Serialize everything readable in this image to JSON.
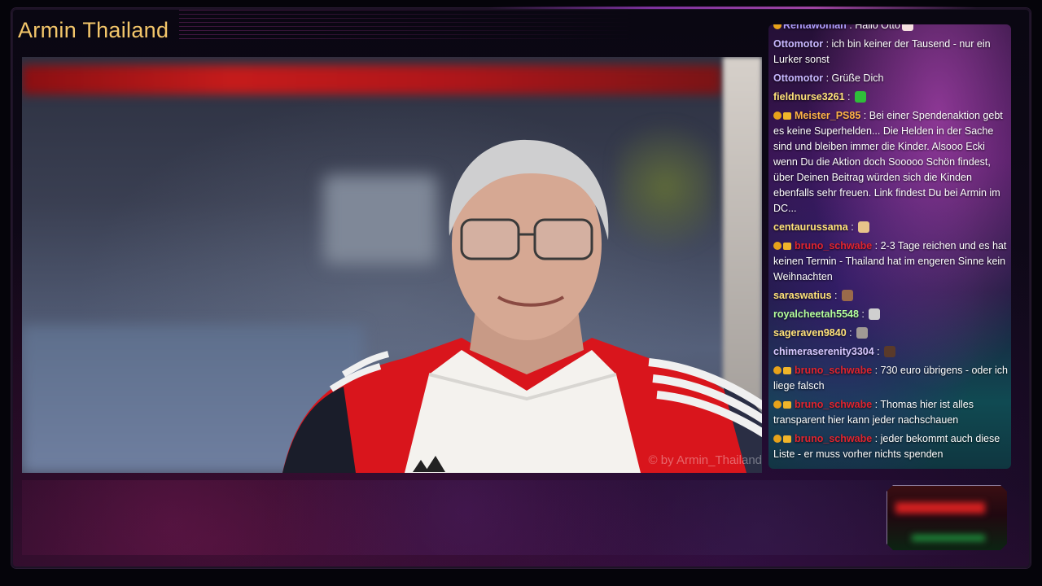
{
  "channel": {
    "title": "Armin Thailand"
  },
  "video": {
    "watermark": "© by Armin_Thailand"
  },
  "chat": {
    "messages": [
      {
        "user": "Rentawoman",
        "sep": " : ",
        "text": "Hallo Otto",
        "user_color": "#b0a0ff",
        "badges": 1,
        "emoji": "#f5e0e0"
      },
      {
        "user": "Ottomotor",
        "sep": " : ",
        "text": "ich bin keiner der Tausend - nur ein Lurker sonst",
        "user_color": "#c8b8ff",
        "badges": 0
      },
      {
        "user": "Ottomotor",
        "sep": " : ",
        "text": "Grüße Dich",
        "user_color": "#c8b8ff",
        "badges": 0
      },
      {
        "user": "fieldnurse3261",
        "sep": " : ",
        "text": "",
        "user_color": "#ffe27a",
        "badges": 0,
        "emoji": "#2fbd3a"
      },
      {
        "user": "Meister_PS85",
        "sep": " : ",
        "text": "Bei einer Spendenaktion gebt es keine Superhelden... Die Helden in der Sache sind und bleiben immer die Kinder. Alsooo Ecki wenn Du die Aktion doch Sooooo Schön findest, über Deinen Beitrag würden sich die Kinden ebenfalls sehr freuen. Link findest Du bei Armin im DC...",
        "user_color": "#ffb347",
        "badges": 2
      },
      {
        "user": "centaurussama",
        "sep": " : ",
        "text": "",
        "user_color": "#ffe27a",
        "badges": 0,
        "emoji": "#e8c38a"
      },
      {
        "user": "bruno_schwabe",
        "sep": " : ",
        "text": "2-3 Tage reichen und es hat keinen Termin - Thailand hat im engeren Sinne kein Weihnachten",
        "user_color": "#e0242f",
        "badges": 2
      },
      {
        "user": "saraswatius",
        "sep": " : ",
        "text": "",
        "user_color": "#ffe27a",
        "badges": 0,
        "emoji": "#9a6a4a"
      },
      {
        "user": "royalcheetah5548",
        "sep": " : ",
        "text": "",
        "user_color": "#b4ff9c",
        "badges": 0,
        "emoji": "#cfcfcf"
      },
      {
        "user": "sageraven9840",
        "sep": " : ",
        "text": "",
        "user_color": "#ffe27a",
        "badges": 0,
        "emoji": "#a09a94"
      },
      {
        "user": "chimeraserenity3304",
        "sep": " : ",
        "text": "",
        "user_color": "#d8c8ff",
        "badges": 0,
        "emoji": "#5a3a2a"
      },
      {
        "user": "bruno_schwabe",
        "sep": " : ",
        "text": "730 euro übrigens - oder ich liege falsch",
        "user_color": "#e0242f",
        "badges": 2
      },
      {
        "user": "bruno_schwabe",
        "sep": " : ",
        "text": "Thomas hier ist alles transparent hier kann jeder nachschauen",
        "user_color": "#e0242f",
        "badges": 2
      },
      {
        "user": "bruno_schwabe",
        "sep": " : ",
        "text": "jeder bekommt auch diese Liste - er muss vorher nichts spenden",
        "user_color": "#e0242f",
        "badges": 2
      }
    ]
  }
}
